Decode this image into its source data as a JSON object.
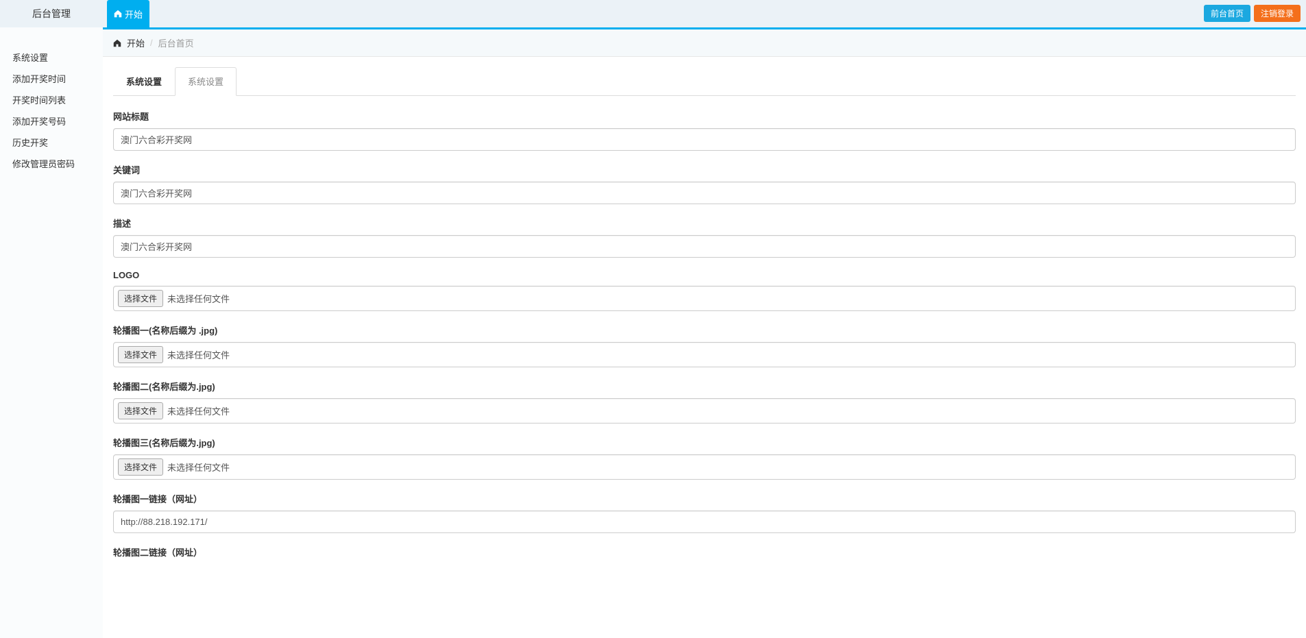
{
  "header": {
    "title": "后台管理",
    "tab_label": "开始",
    "btn_front": "前台首页",
    "btn_logout": "注销登录"
  },
  "sidebar": {
    "items": [
      "系统设置",
      "添加开奖时间",
      "开奖时间列表",
      "添加开奖号码",
      "历史开奖",
      "修改管理员密码"
    ]
  },
  "breadcrumb": {
    "start": "开始",
    "current": "后台首页"
  },
  "tabs": {
    "t1": "系统设置",
    "t2": "系统设置"
  },
  "form": {
    "site_title": {
      "label": "网站标题",
      "value": "澳门六合彩开奖网"
    },
    "keywords": {
      "label": "关键词",
      "value": "澳门六合彩开奖网"
    },
    "description": {
      "label": "描述",
      "value": "澳门六合彩开奖网"
    },
    "logo": {
      "label": "LOGO"
    },
    "carousel1": {
      "label": "轮播图一(名称后缀为 .jpg)"
    },
    "carousel2": {
      "label": "轮播图二(名称后缀为.jpg)"
    },
    "carousel3": {
      "label": "轮播图三(名称后缀为.jpg)"
    },
    "carousel1_link": {
      "label": "轮播图一链接（网址）",
      "value": "http://88.218.192.171/"
    },
    "carousel2_link": {
      "label": "轮播图二链接（网址）"
    },
    "file_button": "选择文件",
    "file_none": "未选择任何文件"
  }
}
